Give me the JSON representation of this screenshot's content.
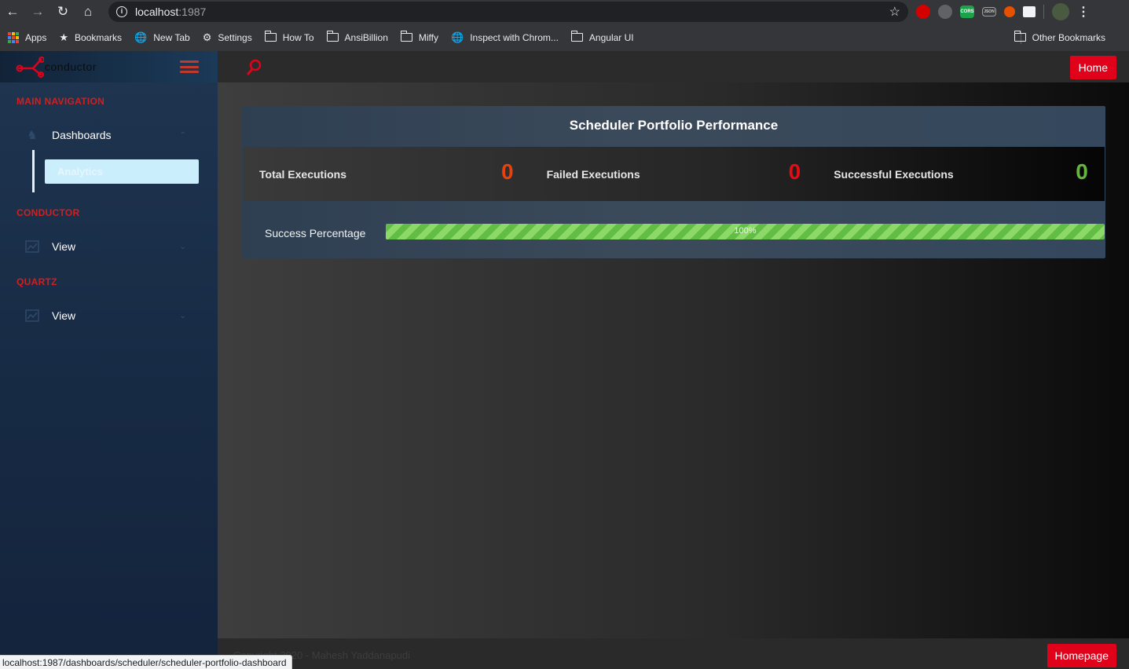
{
  "browser": {
    "url_host": "localhost",
    "url_port": ":1987",
    "bookmarks": [
      {
        "label": "Apps"
      },
      {
        "label": "Bookmarks"
      },
      {
        "label": "New Tab"
      },
      {
        "label": "Settings"
      },
      {
        "label": "How To"
      },
      {
        "label": "AnsiBillion"
      },
      {
        "label": "Miffy"
      },
      {
        "label": "Inspect with Chrom..."
      },
      {
        "label": "Angular UI"
      }
    ],
    "other_bookmarks": "Other Bookmarks",
    "extensions": [
      "stop-extension-icon",
      "chat-extension-icon",
      "cors-extension-icon",
      "json-extension-icon",
      "fox-extension-icon",
      "window-extension-icon"
    ],
    "ext_cors_text": "CORS",
    "ext_json_text": "JSON",
    "status_url": "localhost:1987/dashboards/scheduler/scheduler-portfolio-dashboard"
  },
  "app": {
    "logo_text": "conductor",
    "brand_color": "#e0021b",
    "sidebar": {
      "sections": [
        {
          "header": "MAIN NAVIGATION",
          "item": "Dashboards",
          "sub_item": "Analytics"
        },
        {
          "header": "CONDUCTOR",
          "item": "View"
        },
        {
          "header": "QUARTZ",
          "item": "View"
        }
      ]
    },
    "topbar": {
      "home_label": "Home"
    },
    "dashboard": {
      "title": "Scheduler Portfolio Performance",
      "stats": [
        {
          "label": "Total Executions",
          "value": "0",
          "color": "#e8410c"
        },
        {
          "label": "Failed Executions",
          "value": "0",
          "color": "#e60b14"
        },
        {
          "label": "Successful Executions",
          "value": "0",
          "color": "#63b83b"
        }
      ],
      "progress": {
        "label": "Success Percentage",
        "value": 1.0,
        "text": "100%"
      }
    },
    "footer": {
      "text": "Copyright 2020 - Mahesh Yaddanapudi",
      "homepage_label": "Homepage"
    }
  }
}
